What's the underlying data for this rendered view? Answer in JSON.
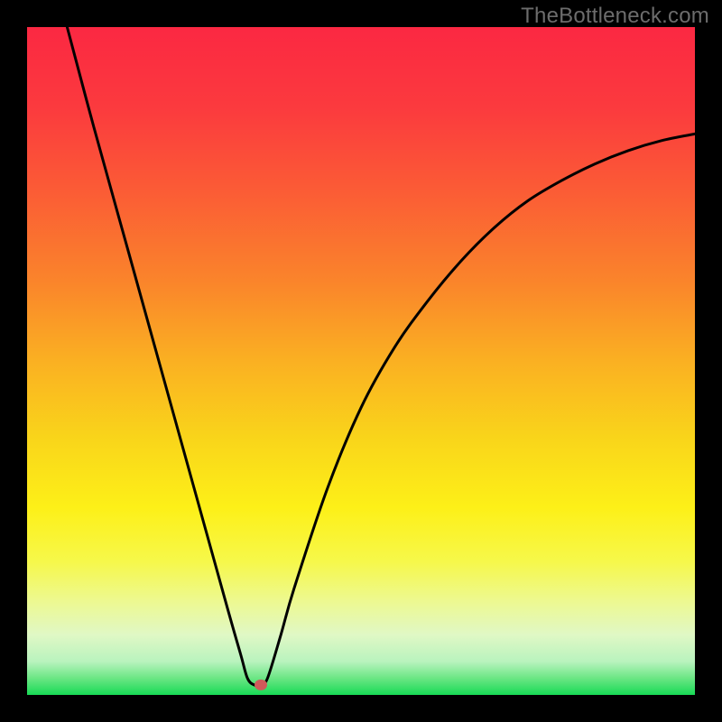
{
  "watermark": "TheBottleneck.com",
  "chart_data": {
    "type": "line",
    "title": "",
    "xlabel": "",
    "ylabel": "",
    "xlim": [
      0,
      100
    ],
    "ylim": [
      0,
      100
    ],
    "grid": false,
    "series": [
      {
        "name": "bottleneck-curve",
        "x": [
          6,
          10,
          15,
          20,
          25,
          30,
          32,
          33,
          34,
          35,
          36,
          38,
          40,
          45,
          50,
          55,
          60,
          65,
          70,
          75,
          80,
          85,
          90,
          95,
          100
        ],
        "y": [
          100,
          85,
          67,
          49,
          31,
          13,
          6,
          2.5,
          1.5,
          1.5,
          2.5,
          9,
          16,
          31,
          43,
          52,
          59,
          65,
          70,
          74,
          77,
          79.5,
          81.5,
          83,
          84
        ]
      }
    ],
    "marker": {
      "x": 35,
      "y": 1.5,
      "color": "#d05a5a"
    },
    "gradient_stops": [
      {
        "offset": 0.0,
        "color": "#fb2842"
      },
      {
        "offset": 0.12,
        "color": "#fb3a3e"
      },
      {
        "offset": 0.25,
        "color": "#fb5d35"
      },
      {
        "offset": 0.38,
        "color": "#fa842b"
      },
      {
        "offset": 0.5,
        "color": "#fab022"
      },
      {
        "offset": 0.62,
        "color": "#f9d61a"
      },
      {
        "offset": 0.72,
        "color": "#fdf018"
      },
      {
        "offset": 0.8,
        "color": "#f6f84a"
      },
      {
        "offset": 0.86,
        "color": "#edf991"
      },
      {
        "offset": 0.91,
        "color": "#e0f8c5"
      },
      {
        "offset": 0.95,
        "color": "#b9f3be"
      },
      {
        "offset": 0.975,
        "color": "#6be684"
      },
      {
        "offset": 1.0,
        "color": "#18da55"
      }
    ],
    "curve_color": "#000000",
    "curve_width": 3
  }
}
